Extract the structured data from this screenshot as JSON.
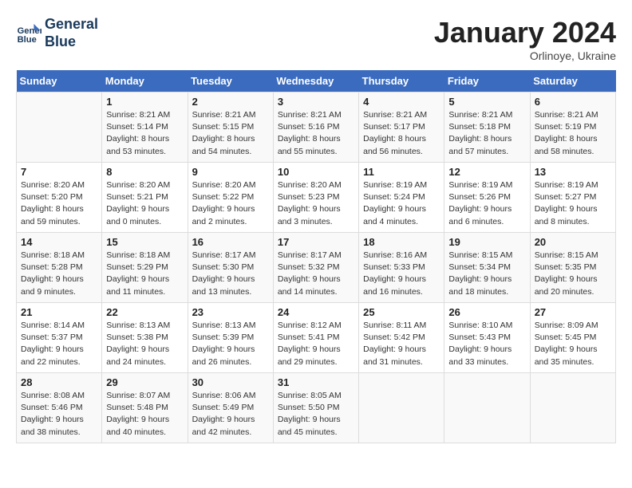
{
  "header": {
    "logo_line1": "General",
    "logo_line2": "Blue",
    "month": "January 2024",
    "location": "Orlinoye, Ukraine"
  },
  "weekdays": [
    "Sunday",
    "Monday",
    "Tuesday",
    "Wednesday",
    "Thursday",
    "Friday",
    "Saturday"
  ],
  "weeks": [
    [
      {
        "day": "",
        "info": ""
      },
      {
        "day": "1",
        "info": "Sunrise: 8:21 AM\nSunset: 5:14 PM\nDaylight: 8 hours\nand 53 minutes."
      },
      {
        "day": "2",
        "info": "Sunrise: 8:21 AM\nSunset: 5:15 PM\nDaylight: 8 hours\nand 54 minutes."
      },
      {
        "day": "3",
        "info": "Sunrise: 8:21 AM\nSunset: 5:16 PM\nDaylight: 8 hours\nand 55 minutes."
      },
      {
        "day": "4",
        "info": "Sunrise: 8:21 AM\nSunset: 5:17 PM\nDaylight: 8 hours\nand 56 minutes."
      },
      {
        "day": "5",
        "info": "Sunrise: 8:21 AM\nSunset: 5:18 PM\nDaylight: 8 hours\nand 57 minutes."
      },
      {
        "day": "6",
        "info": "Sunrise: 8:21 AM\nSunset: 5:19 PM\nDaylight: 8 hours\nand 58 minutes."
      }
    ],
    [
      {
        "day": "7",
        "info": "Sunrise: 8:20 AM\nSunset: 5:20 PM\nDaylight: 8 hours\nand 59 minutes."
      },
      {
        "day": "8",
        "info": "Sunrise: 8:20 AM\nSunset: 5:21 PM\nDaylight: 9 hours\nand 0 minutes."
      },
      {
        "day": "9",
        "info": "Sunrise: 8:20 AM\nSunset: 5:22 PM\nDaylight: 9 hours\nand 2 minutes."
      },
      {
        "day": "10",
        "info": "Sunrise: 8:20 AM\nSunset: 5:23 PM\nDaylight: 9 hours\nand 3 minutes."
      },
      {
        "day": "11",
        "info": "Sunrise: 8:19 AM\nSunset: 5:24 PM\nDaylight: 9 hours\nand 4 minutes."
      },
      {
        "day": "12",
        "info": "Sunrise: 8:19 AM\nSunset: 5:26 PM\nDaylight: 9 hours\nand 6 minutes."
      },
      {
        "day": "13",
        "info": "Sunrise: 8:19 AM\nSunset: 5:27 PM\nDaylight: 9 hours\nand 8 minutes."
      }
    ],
    [
      {
        "day": "14",
        "info": "Sunrise: 8:18 AM\nSunset: 5:28 PM\nDaylight: 9 hours\nand 9 minutes."
      },
      {
        "day": "15",
        "info": "Sunrise: 8:18 AM\nSunset: 5:29 PM\nDaylight: 9 hours\nand 11 minutes."
      },
      {
        "day": "16",
        "info": "Sunrise: 8:17 AM\nSunset: 5:30 PM\nDaylight: 9 hours\nand 13 minutes."
      },
      {
        "day": "17",
        "info": "Sunrise: 8:17 AM\nSunset: 5:32 PM\nDaylight: 9 hours\nand 14 minutes."
      },
      {
        "day": "18",
        "info": "Sunrise: 8:16 AM\nSunset: 5:33 PM\nDaylight: 9 hours\nand 16 minutes."
      },
      {
        "day": "19",
        "info": "Sunrise: 8:15 AM\nSunset: 5:34 PM\nDaylight: 9 hours\nand 18 minutes."
      },
      {
        "day": "20",
        "info": "Sunrise: 8:15 AM\nSunset: 5:35 PM\nDaylight: 9 hours\nand 20 minutes."
      }
    ],
    [
      {
        "day": "21",
        "info": "Sunrise: 8:14 AM\nSunset: 5:37 PM\nDaylight: 9 hours\nand 22 minutes."
      },
      {
        "day": "22",
        "info": "Sunrise: 8:13 AM\nSunset: 5:38 PM\nDaylight: 9 hours\nand 24 minutes."
      },
      {
        "day": "23",
        "info": "Sunrise: 8:13 AM\nSunset: 5:39 PM\nDaylight: 9 hours\nand 26 minutes."
      },
      {
        "day": "24",
        "info": "Sunrise: 8:12 AM\nSunset: 5:41 PM\nDaylight: 9 hours\nand 29 minutes."
      },
      {
        "day": "25",
        "info": "Sunrise: 8:11 AM\nSunset: 5:42 PM\nDaylight: 9 hours\nand 31 minutes."
      },
      {
        "day": "26",
        "info": "Sunrise: 8:10 AM\nSunset: 5:43 PM\nDaylight: 9 hours\nand 33 minutes."
      },
      {
        "day": "27",
        "info": "Sunrise: 8:09 AM\nSunset: 5:45 PM\nDaylight: 9 hours\nand 35 minutes."
      }
    ],
    [
      {
        "day": "28",
        "info": "Sunrise: 8:08 AM\nSunset: 5:46 PM\nDaylight: 9 hours\nand 38 minutes."
      },
      {
        "day": "29",
        "info": "Sunrise: 8:07 AM\nSunset: 5:48 PM\nDaylight: 9 hours\nand 40 minutes."
      },
      {
        "day": "30",
        "info": "Sunrise: 8:06 AM\nSunset: 5:49 PM\nDaylight: 9 hours\nand 42 minutes."
      },
      {
        "day": "31",
        "info": "Sunrise: 8:05 AM\nSunset: 5:50 PM\nDaylight: 9 hours\nand 45 minutes."
      },
      {
        "day": "",
        "info": ""
      },
      {
        "day": "",
        "info": ""
      },
      {
        "day": "",
        "info": ""
      }
    ]
  ]
}
